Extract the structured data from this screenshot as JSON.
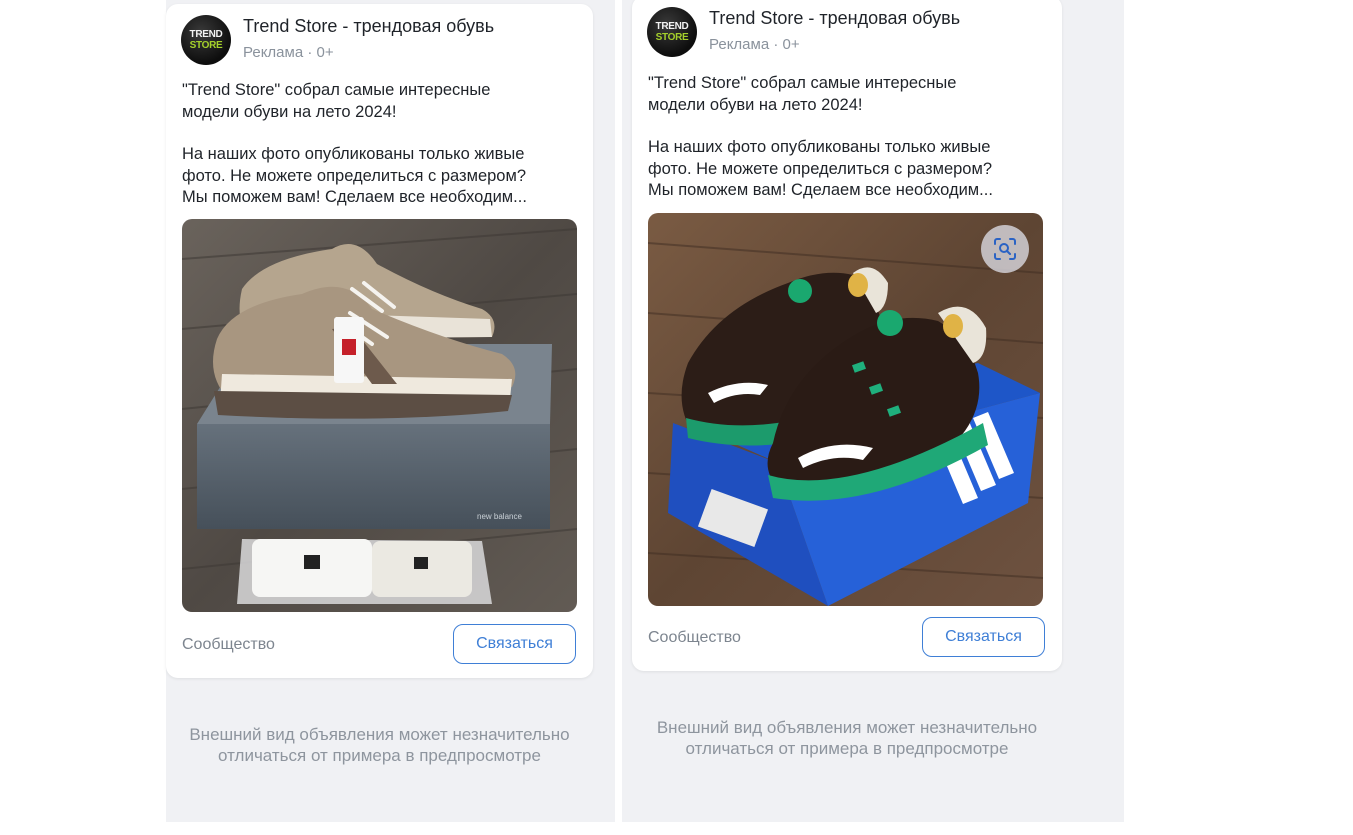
{
  "colors": {
    "panel_bg": "#f0f1f4",
    "card_bg": "#ffffff",
    "accent": "#3f7fd6",
    "muted_text": "#8a929c",
    "avatar_brand_green": "#a4d02b"
  },
  "previews": [
    {
      "avatar": {
        "icon": "trend-store-logo-icon",
        "line1": "TREND",
        "line2": "STORE"
      },
      "author": "Trend Store - трендовая обувь",
      "meta": "Реклама · 0+",
      "text_p1_l1": "\"Trend Store\" собрал самые интересные",
      "text_p1_l2": "модели обуви на лето 2024!",
      "text_p2_l1": "На наших фото опубликованы только живые",
      "text_p2_l2": "фото. Не можете определиться с размером?",
      "text_p2_l3": "Мы поможем вам! Сделаем все необходим...",
      "image_icon": "sneakers-photo",
      "footer_label": "Сообщество",
      "contact_label": "Связаться",
      "disclaimer_l1": "Внешний вид объявления может незначительно",
      "disclaimer_l2": "отличаться от примера в предпросмотре"
    },
    {
      "avatar": {
        "icon": "trend-store-logo-icon",
        "line1": "TREND",
        "line2": "STORE"
      },
      "author": "Trend Store - трендовая обувь",
      "meta": "Реклама · 0+",
      "text_p1_l1": "\"Trend Store\" собрал самые интересные",
      "text_p1_l2": "модели обуви на лето 2024!",
      "text_p2_l1": "На наших фото опубликованы только живые",
      "text_p2_l2": "фото. Не можете определиться с размером?",
      "text_p2_l3": "Мы поможем вам! Сделаем все необходим...",
      "image_icon": "sneakers-photo",
      "scan_icon": "image-search-icon",
      "footer_label": "Сообщество",
      "contact_label": "Связаться",
      "disclaimer_l1": "Внешний вид объявления может незначительно",
      "disclaimer_l2": "отличаться от примера в предпросмотре"
    }
  ]
}
